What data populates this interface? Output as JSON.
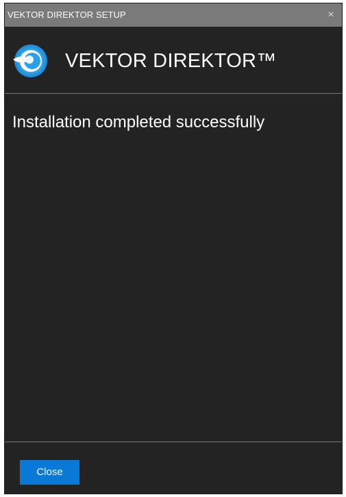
{
  "window": {
    "title": "VEKTOR DIREKTOR SETUP",
    "close_glyph": "×"
  },
  "header": {
    "logo_icon": "vektor-direktor-logo-icon",
    "product_name": "VEKTOR DIREKTOR™"
  },
  "main": {
    "status_message": "Installation completed successfully"
  },
  "footer": {
    "close_button_label": "Close"
  },
  "colors": {
    "titlebar": "#7a7a7a",
    "window_bg": "#232323",
    "accent_button": "#0a78d7",
    "logo_blue": "#2aa0ea"
  }
}
